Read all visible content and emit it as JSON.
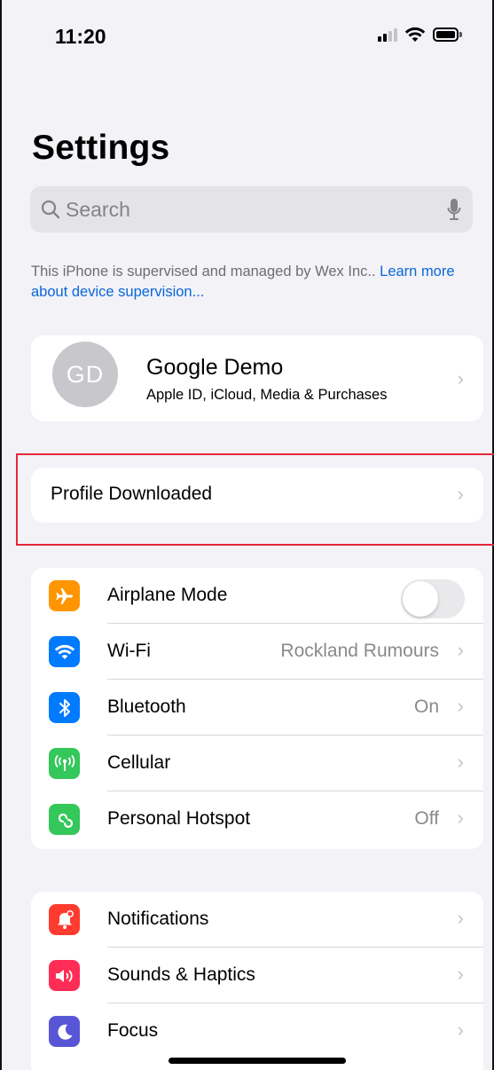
{
  "status_bar": {
    "time": "11:20"
  },
  "title": "Settings",
  "search": {
    "placeholder": "Search"
  },
  "supervision": {
    "text": "This iPhone is supervised and managed by Wex Inc.. ",
    "link": "Learn more about device supervision..."
  },
  "profile": {
    "initials": "GD",
    "name": "Google Demo",
    "subtitle": "Apple ID, iCloud, Media & Purchases"
  },
  "profile_downloaded": {
    "label": "Profile Downloaded"
  },
  "connectivity": [
    {
      "label": "Airplane Mode",
      "icon": "airplane-icon",
      "color": "#ff9500",
      "toggle": false
    },
    {
      "label": "Wi-Fi",
      "icon": "wifi-icon",
      "color": "#007aff",
      "value": "Rockland Rumours"
    },
    {
      "label": "Bluetooth",
      "icon": "bluetooth-icon",
      "color": "#007aff",
      "value": "On"
    },
    {
      "label": "Cellular",
      "icon": "cellular-icon",
      "color": "#34c759",
      "value": ""
    },
    {
      "label": "Personal Hotspot",
      "icon": "hotspot-icon",
      "color": "#34c759",
      "value": "Off"
    }
  ],
  "system": [
    {
      "label": "Notifications",
      "icon": "notifications-icon",
      "color": "#ff3b30"
    },
    {
      "label": "Sounds & Haptics",
      "icon": "sounds-icon",
      "color": "#ff2d55"
    },
    {
      "label": "Focus",
      "icon": "focus-moon-icon",
      "color": "#5856d6"
    }
  ]
}
